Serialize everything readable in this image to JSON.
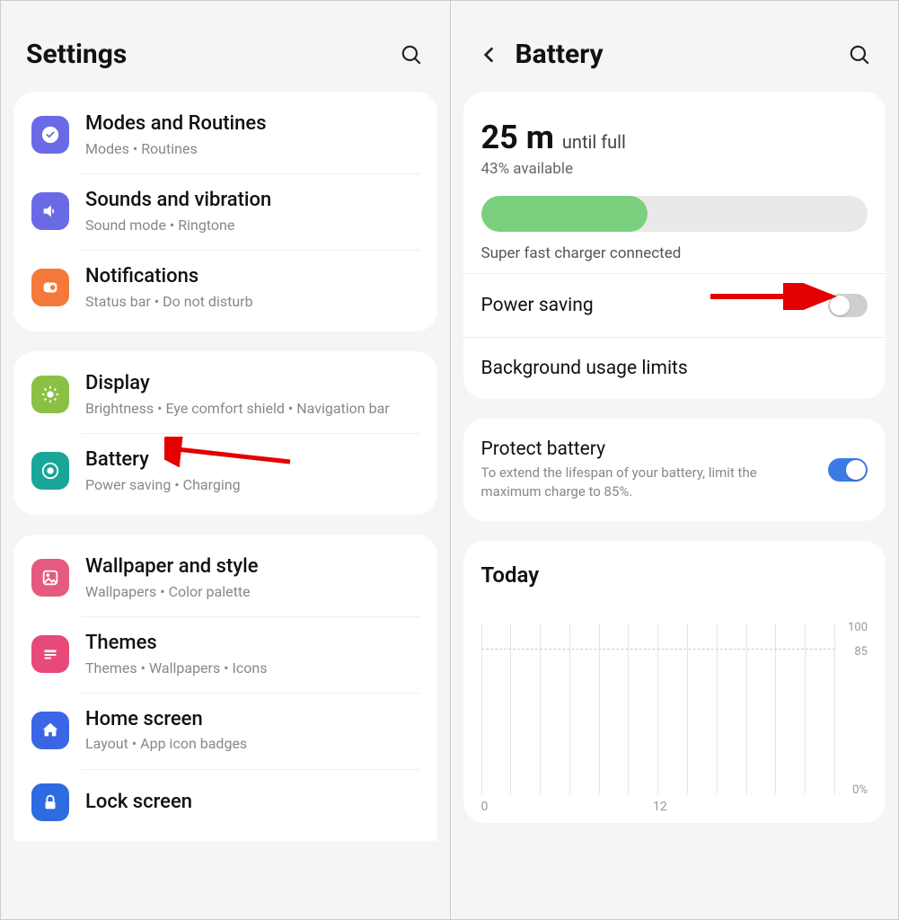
{
  "left": {
    "title": "Settings",
    "groups": [
      [
        {
          "icon": "check-icon",
          "color": "ic-purple",
          "title": "Modes and Routines",
          "sub": "Modes  •  Routines"
        },
        {
          "icon": "speaker-icon",
          "color": "ic-purple",
          "title": "Sounds and vibration",
          "sub": "Sound mode  •  Ringtone"
        },
        {
          "icon": "bell-icon",
          "color": "ic-orange",
          "title": "Notifications",
          "sub": "Status bar  •  Do not disturb"
        }
      ],
      [
        {
          "icon": "sun-icon",
          "color": "ic-green",
          "title": "Display",
          "sub": "Brightness  •  Eye comfort shield  •  Navigation bar"
        },
        {
          "icon": "battery-icon",
          "color": "ic-teal",
          "title": "Battery",
          "sub": "Power saving  •  Charging"
        }
      ],
      [
        {
          "icon": "image-icon",
          "color": "ic-pink",
          "title": "Wallpaper and style",
          "sub": "Wallpapers  •  Color palette"
        },
        {
          "icon": "theme-icon",
          "color": "ic-pink2",
          "title": "Themes",
          "sub": "Themes  •  Wallpapers  •  Icons"
        },
        {
          "icon": "home-icon",
          "color": "ic-blue",
          "title": "Home screen",
          "sub": "Layout  •  App icon badges"
        },
        {
          "icon": "lock-icon",
          "color": "ic-blue2",
          "title": "Lock screen",
          "sub": ""
        }
      ]
    ]
  },
  "right": {
    "title": "Battery",
    "stats": {
      "time_value": "25 m",
      "time_suffix": "until full",
      "available": "43% available",
      "percent_fill": 43,
      "charger_text": "Super fast charger connected"
    },
    "power_saving_label": "Power saving",
    "bg_limits_label": "Background usage limits",
    "protect_title": "Protect battery",
    "protect_desc": "To extend the lifespan of your battery, limit the maximum charge to 85%.",
    "protect_on": true,
    "chart_title": "Today"
  },
  "chart_data": {
    "type": "line",
    "title": "Today",
    "xlabel": "",
    "ylabel": "",
    "ylim": [
      0,
      100
    ],
    "y_ticks": [
      0,
      85,
      100
    ],
    "x_ticks": [
      "0",
      "12"
    ],
    "x": [],
    "values": []
  }
}
